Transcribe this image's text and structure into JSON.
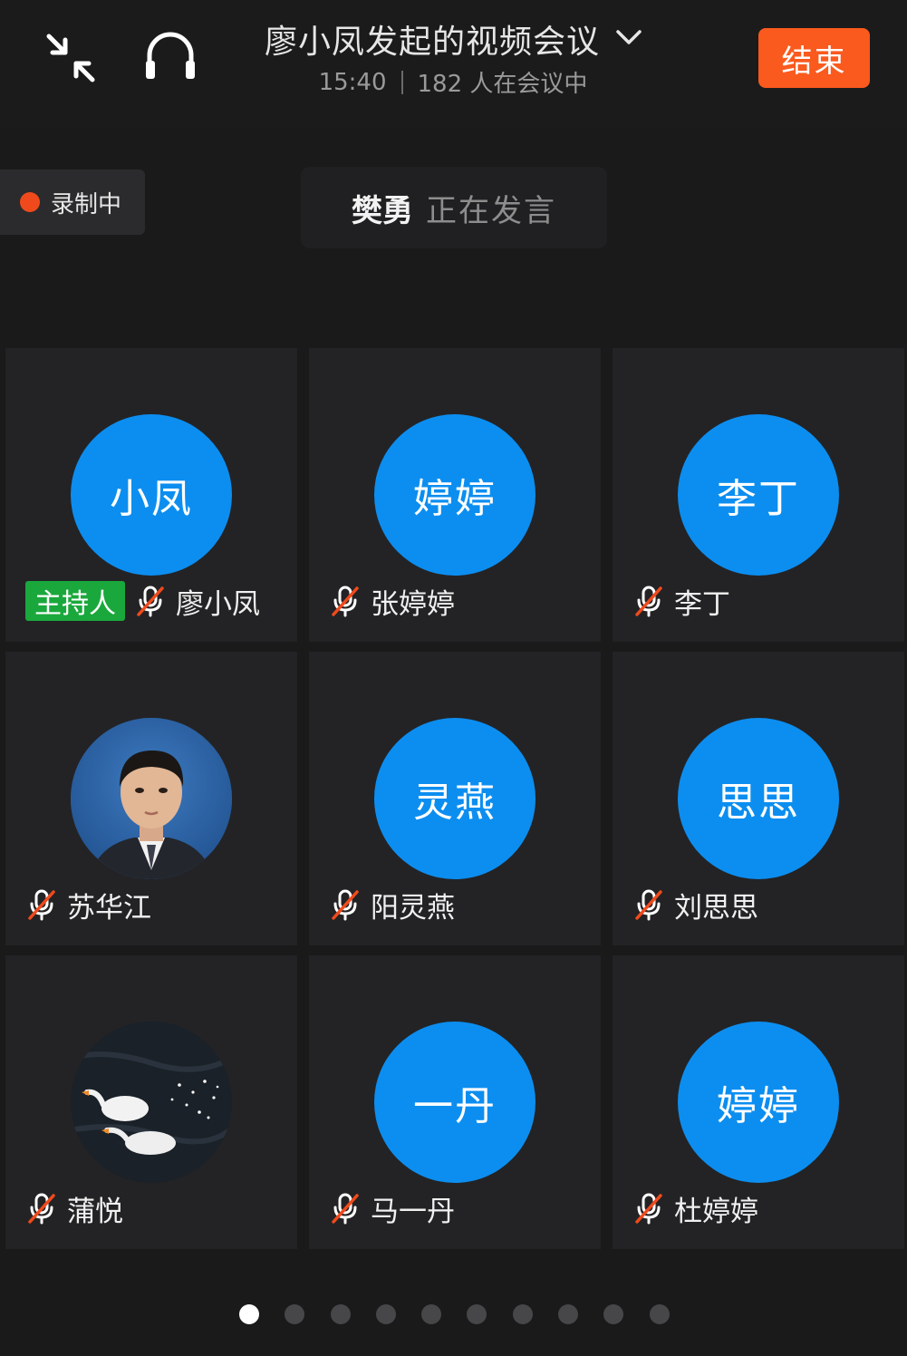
{
  "header": {
    "title": "廖小凤发起的视频会议",
    "time": "15:40",
    "participants": "182 人在会议中",
    "end_label": "结束",
    "icons": [
      "shrink-window-icon",
      "headphones-icon",
      "chevron-down-icon"
    ]
  },
  "recording": {
    "label": "录制中",
    "dot_color": "#f04a1c"
  },
  "speaking": {
    "name": "樊勇",
    "status": "正在发言"
  },
  "participants": [
    {
      "avatar_text": "小凤",
      "name": "廖小凤",
      "host_label": "主持人",
      "muted": true
    },
    {
      "avatar_text": "婷婷",
      "name": "张婷婷",
      "muted": true
    },
    {
      "avatar_text": "李丁",
      "name": "李丁",
      "muted": true
    },
    {
      "avatar_text": "",
      "avatar_type": "photo",
      "name": "苏华江",
      "muted": true
    },
    {
      "avatar_text": "灵燕",
      "name": "阳灵燕",
      "muted": true
    },
    {
      "avatar_text": "思思",
      "name": "刘思思",
      "muted": true
    },
    {
      "avatar_text": "",
      "avatar_type": "swan-image",
      "name": "蒲悦",
      "muted": true
    },
    {
      "avatar_text": "一丹",
      "name": "马一丹",
      "muted": true
    },
    {
      "avatar_text": "婷婷",
      "name": "杜婷婷",
      "muted": true
    }
  ],
  "pagination": {
    "pages": 10,
    "current": 1
  },
  "colors": {
    "background": "#1a1a1b",
    "tile": "#232325",
    "avatar": "#0c8ef0",
    "end_button": "#fa5a1e",
    "host_badge": "#1aa83c",
    "muted_slash": "#f04a1c"
  }
}
